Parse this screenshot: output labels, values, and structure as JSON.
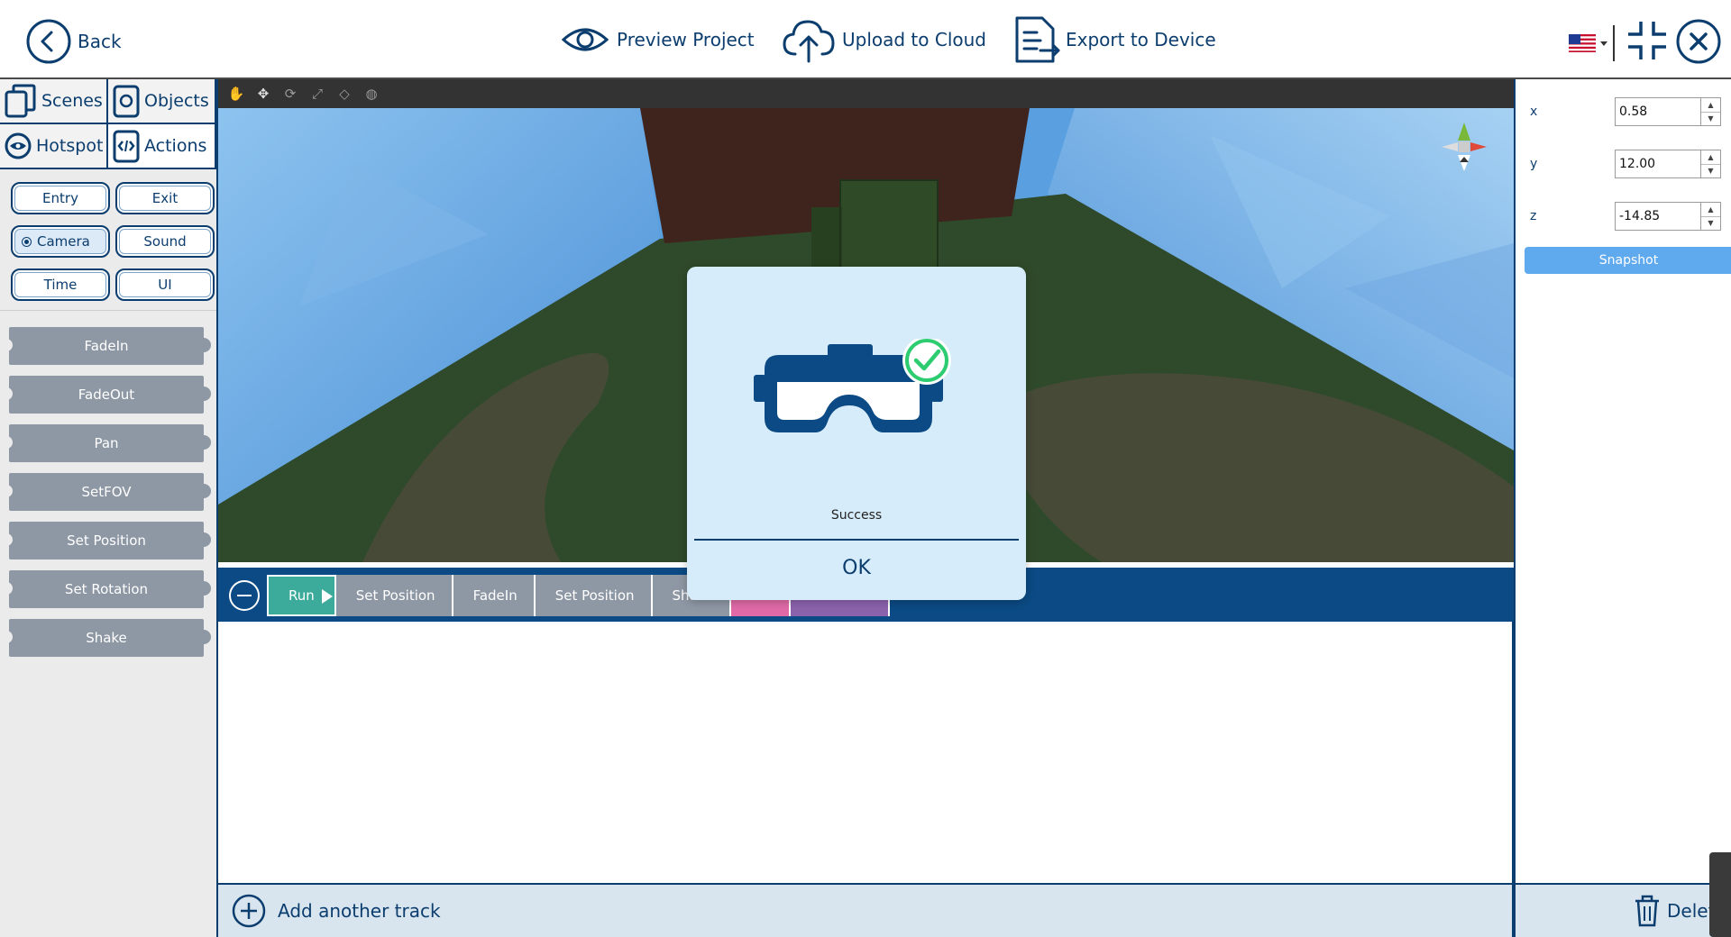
{
  "header": {
    "back_label": "Back",
    "preview_label": "Preview Project",
    "upload_label": "Upload to Cloud",
    "export_label": "Export to Device",
    "language": "en-US"
  },
  "sidebar": {
    "tabs": [
      {
        "label": "Scenes",
        "icon": "scenes-icon"
      },
      {
        "label": "Objects",
        "icon": "objects-icon"
      },
      {
        "label": "Hotspot",
        "icon": "eye-icon"
      },
      {
        "label": "Actions",
        "icon": "code-icon"
      }
    ],
    "filters": [
      "Entry",
      "Exit",
      "Camera",
      "Sound",
      "Time",
      "UI"
    ],
    "selected_filter": "Camera",
    "actions": [
      "FadeIn",
      "FadeOut",
      "Pan",
      "SetFOV",
      "Set Position",
      "Set Rotation",
      "Shake"
    ]
  },
  "timeline": {
    "run_label": "Run",
    "blocks": [
      "Set Position",
      "FadeIn",
      "Set Position",
      "Shake"
    ],
    "add_track_label": "Add another track"
  },
  "properties": {
    "x_label": "x",
    "x_value": "0.58",
    "y_label": "y",
    "y_value": "12.00",
    "z_label": "z",
    "z_value": "-14.85",
    "snapshot_label": "Snapshot",
    "delete_label": "Delet"
  },
  "modal": {
    "message": "Success",
    "ok_label": "OK"
  },
  "colors": {
    "brand": "#0b3d6e",
    "timeline_bar": "#0b4a84",
    "success": "#2ecc71",
    "snapshot": "#5fa9ee"
  }
}
